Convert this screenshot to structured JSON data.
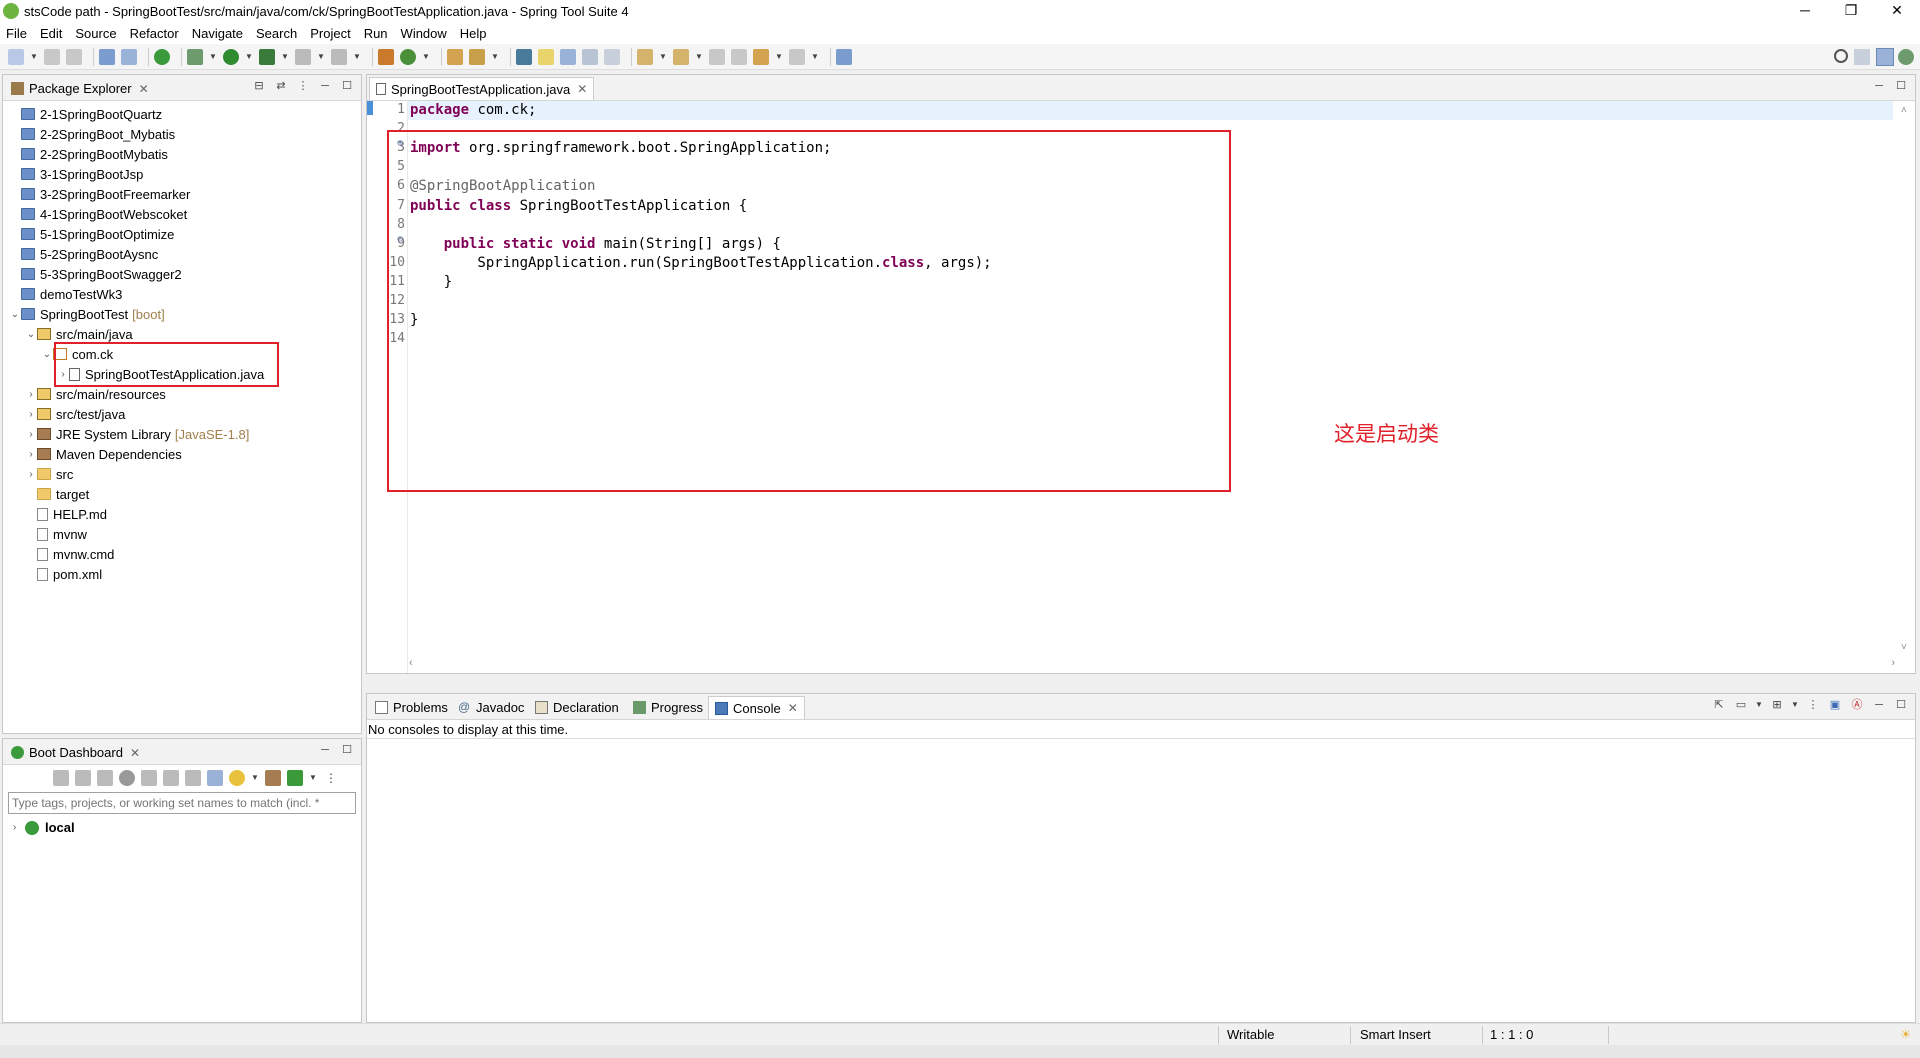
{
  "window": {
    "title": "stsCode path - SpringBootTest/src/main/java/com/ck/SpringBootTestApplication.java - Spring Tool Suite 4",
    "minimize": "─",
    "restore": "❐",
    "close": "✕"
  },
  "menu": [
    "File",
    "Edit",
    "Source",
    "Refactor",
    "Navigate",
    "Search",
    "Project",
    "Run",
    "Window",
    "Help"
  ],
  "package_explorer": {
    "tab_label": "Package Explorer",
    "items": [
      {
        "label": "2-1SpringBootQuartz",
        "type": "project",
        "level": 0
      },
      {
        "label": "2-2SpringBoot_Mybatis",
        "type": "project",
        "level": 0
      },
      {
        "label": "2-2SpringBootMybatis",
        "type": "project",
        "level": 0
      },
      {
        "label": "3-1SpringBootJsp",
        "type": "project",
        "level": 0
      },
      {
        "label": "3-2SpringBootFreemarker",
        "type": "project",
        "level": 0
      },
      {
        "label": "4-1SpringBootWebscoket",
        "type": "project",
        "level": 0
      },
      {
        "label": "5-1SpringBootOptimize",
        "type": "project",
        "level": 0
      },
      {
        "label": "5-2SpringBootAysnc",
        "type": "project",
        "level": 0
      },
      {
        "label": "5-3SpringBootSwagger2",
        "type": "project",
        "level": 0
      },
      {
        "label": "demoTestWk3",
        "type": "project",
        "level": 0
      },
      {
        "label": "SpringBootTest",
        "decoration": "[boot]",
        "type": "project",
        "level": 0,
        "expanded": true
      },
      {
        "label": "src/main/java",
        "type": "srcfolder",
        "level": 1,
        "expanded": true
      },
      {
        "label": "com.ck",
        "type": "pkg",
        "level": 2,
        "expanded": true
      },
      {
        "label": "SpringBootTestApplication.java",
        "type": "jfile",
        "level": 3,
        "selected": true
      },
      {
        "label": "src/main/resources",
        "type": "srcfolder",
        "level": 1
      },
      {
        "label": "src/test/java",
        "type": "srcfolder",
        "level": 1
      },
      {
        "label": "JRE System Library",
        "decoration": "[JavaSE-1.8]",
        "type": "lib",
        "level": 1
      },
      {
        "label": "Maven Dependencies",
        "type": "lib",
        "level": 1
      },
      {
        "label": "src",
        "type": "folder",
        "level": 1
      },
      {
        "label": "target",
        "type": "folder",
        "level": 1
      },
      {
        "label": "HELP.md",
        "type": "file",
        "level": 1
      },
      {
        "label": "mvnw",
        "type": "file",
        "level": 1
      },
      {
        "label": "mvnw.cmd",
        "type": "file",
        "level": 1
      },
      {
        "label": "pom.xml",
        "type": "file",
        "level": 1
      }
    ]
  },
  "editor": {
    "tab_label": "SpringBootTestApplication.java",
    "lines": [
      {
        "n": "1",
        "tokens": [
          {
            "t": "package",
            "k": "kw"
          },
          {
            "t": " com.ck;"
          }
        ]
      },
      {
        "n": "2",
        "tokens": []
      },
      {
        "n": "3",
        "fold": "⊕",
        "tokens": [
          {
            "t": "import",
            "k": "kw"
          },
          {
            "t": " org.springframework.boot.SpringApplication;"
          }
        ]
      },
      {
        "n": "5",
        "tokens": []
      },
      {
        "n": "6",
        "tokens": [
          {
            "t": "@SpringBootApplication",
            "k": "anno"
          }
        ]
      },
      {
        "n": "7",
        "tokens": [
          {
            "t": "public",
            "k": "kw"
          },
          {
            "t": " "
          },
          {
            "t": "class",
            "k": "kw"
          },
          {
            "t": " SpringBootTestApplication {"
          }
        ]
      },
      {
        "n": "8",
        "tokens": []
      },
      {
        "n": "9",
        "fold": "⊖",
        "tokens": [
          {
            "t": "    "
          },
          {
            "t": "public",
            "k": "kw"
          },
          {
            "t": " "
          },
          {
            "t": "static",
            "k": "kw"
          },
          {
            "t": " "
          },
          {
            "t": "void",
            "k": "kw"
          },
          {
            "t": " main(String[] args) {"
          }
        ]
      },
      {
        "n": "10",
        "tokens": [
          {
            "t": "        SpringApplication.run(SpringBootTestApplication."
          },
          {
            "t": "class",
            "k": "kw"
          },
          {
            "t": ", args);"
          }
        ]
      },
      {
        "n": "11",
        "tokens": [
          {
            "t": "    }"
          }
        ]
      },
      {
        "n": "12",
        "tokens": []
      },
      {
        "n": "13",
        "tokens": [
          {
            "t": "}"
          }
        ]
      },
      {
        "n": "14",
        "tokens": []
      }
    ],
    "annotation": "这是启动类"
  },
  "bottom_panel": {
    "tabs": [
      "Problems",
      "Javadoc",
      "Declaration",
      "Progress",
      "Console"
    ],
    "active": "Console",
    "message": "No consoles to display at this time."
  },
  "boot_dashboard": {
    "tab_label": "Boot Dashboard",
    "filter_placeholder": "Type tags, projects, or working set names to match (incl. *",
    "items": [
      {
        "label": "local"
      }
    ]
  },
  "status": {
    "writable": "Writable",
    "insert_mode": "Smart Insert",
    "position": "1 : 1 : 0"
  },
  "colors": {
    "keyword": "#7f0055",
    "annotation_box": "#e0202a",
    "spring_green": "#6db33f"
  }
}
